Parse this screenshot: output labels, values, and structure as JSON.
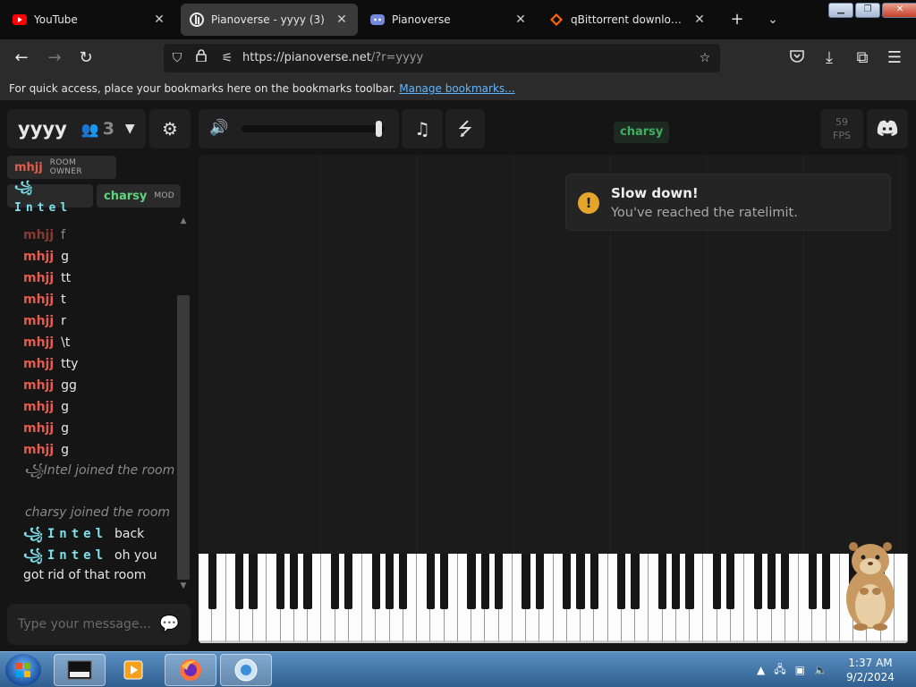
{
  "browser": {
    "tabs": [
      {
        "title": "YouTube",
        "icon": "youtube-icon"
      },
      {
        "title": "Pianoverse - yyyy (3)",
        "icon": "pianoverse-icon",
        "active": true
      },
      {
        "title": "Pianoverse",
        "icon": "discord-icon"
      },
      {
        "title": "qBittorrent download | Sou",
        "icon": "sourceforge-icon"
      }
    ],
    "url_host": "https://pianoverse.net",
    "url_path": "/?r=yyyy",
    "bookmarks_text": "For quick access, place your bookmarks here on the bookmarks toolbar.",
    "bookmarks_link": "Manage bookmarks..."
  },
  "room": {
    "name": "yyyy",
    "user_count": "3"
  },
  "users": [
    {
      "name": "mhjj",
      "badge": "ROOM OWNER",
      "color": "#e35b4b"
    },
    {
      "name": "꧁Intel",
      "badge": "",
      "color": "#7ee1ec"
    },
    {
      "name": "charsy",
      "badge": "MOD",
      "color": "#5ed67c"
    }
  ],
  "chat": {
    "messages": [
      {
        "who": "mhjj",
        "text": "f"
      },
      {
        "who": "mhjj",
        "text": "g"
      },
      {
        "who": "mhjj",
        "text": "tt"
      },
      {
        "who": "mhjj",
        "text": "t"
      },
      {
        "who": "mhjj",
        "text": "r"
      },
      {
        "who": "mhjj",
        "text": "\\t"
      },
      {
        "who": "mhjj",
        "text": "tty"
      },
      {
        "who": "mhjj",
        "text": "gg"
      },
      {
        "who": "mhjj",
        "text": "g"
      },
      {
        "who": "mhjj",
        "text": "g"
      },
      {
        "who": "mhjj",
        "text": "g"
      }
    ],
    "system_1": "꧁Intel joined the room",
    "system_2": "charsy joined the room",
    "intel_msg_1_who": "꧁Intel",
    "intel_msg_1_text": "back",
    "intel_msg_2_who": "꧁Intel",
    "intel_msg_2_text": "oh you got rid of that room",
    "input_placeholder": "Type your message..."
  },
  "controls": {
    "volume_level": 0.98,
    "player_tag": "charsy",
    "fps_value": "59",
    "fps_label": "FPS"
  },
  "toast": {
    "title": "Slow down!",
    "message": "You've reached the ratelimit."
  },
  "taskbar": {
    "time": "1:37 AM",
    "date": "9/2/2024"
  },
  "colors": {
    "owner": "#e35b4b",
    "intel": "#7ee1ec",
    "mod": "#5ed67c",
    "warning": "#e5a52a"
  }
}
